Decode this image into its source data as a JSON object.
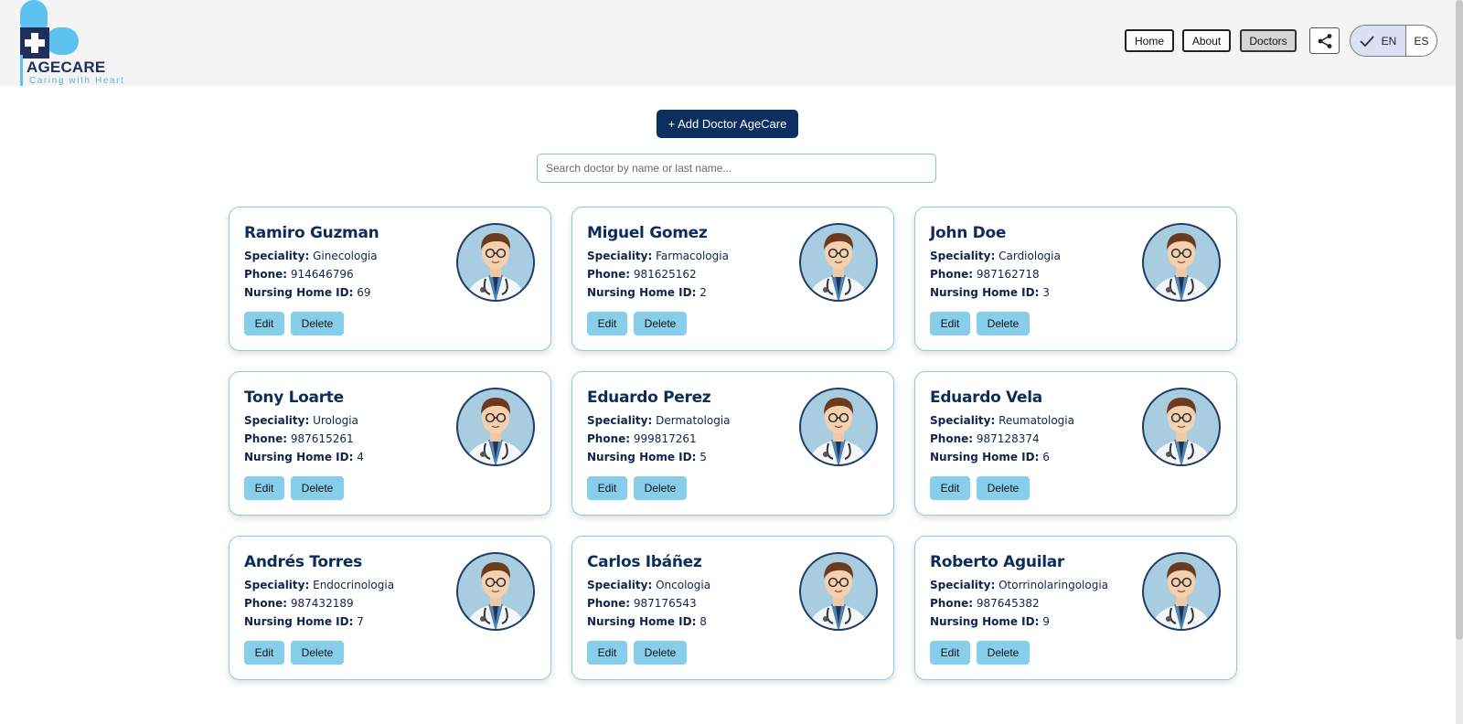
{
  "brand": {
    "name": "AGECARE",
    "tagline": "Caring with Heart"
  },
  "nav": {
    "home": "Home",
    "about": "About",
    "doctors": "Doctors"
  },
  "language": {
    "en": "EN",
    "es": "ES",
    "selected": "EN"
  },
  "actions": {
    "add_doctor": "+ Add Doctor AgeCare"
  },
  "search": {
    "placeholder": "Search doctor by name or last name..."
  },
  "labels": {
    "speciality": "Speciality:",
    "phone": "Phone:",
    "nursing_home_id": "Nursing Home ID:",
    "edit": "Edit",
    "delete": "Delete"
  },
  "doctors": [
    {
      "name": "Ramiro Guzman",
      "speciality": "Ginecologia",
      "phone": "914646796",
      "nursing_home_id": "69"
    },
    {
      "name": "Miguel Gomez",
      "speciality": "Farmacologia",
      "phone": "981625162",
      "nursing_home_id": "2"
    },
    {
      "name": "John Doe",
      "speciality": "Cardiologia",
      "phone": "987162718",
      "nursing_home_id": "3"
    },
    {
      "name": "Tony Loarte",
      "speciality": "Urologia",
      "phone": "987615261",
      "nursing_home_id": "4"
    },
    {
      "name": "Eduardo Perez",
      "speciality": "Dermatologia",
      "phone": "999817261",
      "nursing_home_id": "5"
    },
    {
      "name": "Eduardo Vela",
      "speciality": "Reumatologia",
      "phone": "987128374",
      "nursing_home_id": "6"
    },
    {
      "name": "Andrés Torres",
      "speciality": "Endocrinologia",
      "phone": "987432189",
      "nursing_home_id": "7"
    },
    {
      "name": "Carlos Ibáñez",
      "speciality": "Oncologia",
      "phone": "987176543",
      "nursing_home_id": "8"
    },
    {
      "name": "Roberto Aguilar",
      "speciality": "Otorrinolaringologia",
      "phone": "987645382",
      "nursing_home_id": "9"
    }
  ],
  "colors": {
    "brand_dark": "#0b2f5e",
    "accent": "#87ceeb",
    "card_border": "#8ec8e6"
  },
  "icons": {
    "share": "share-icon",
    "check": "check-icon",
    "avatar": "doctor-avatar-icon"
  }
}
